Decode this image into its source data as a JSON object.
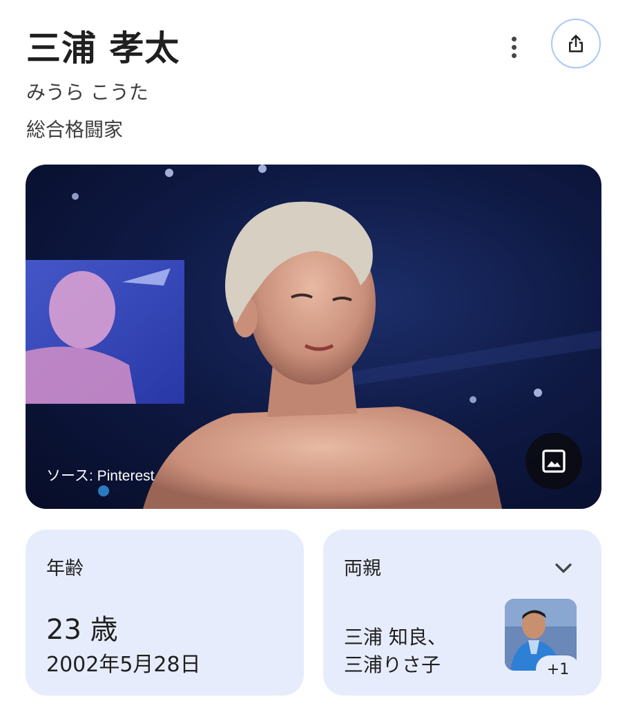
{
  "header": {
    "title": "三浦 孝太",
    "reading": "みうら こうた",
    "occupation": "総合格闘家"
  },
  "hero_image": {
    "source_label": "ソース: Pinterest"
  },
  "age_card": {
    "label": "年齢",
    "value": "23 歳",
    "birth_date": "2002年5月28日"
  },
  "parents_card": {
    "label": "両親",
    "names_line1": "三浦 知良、",
    "names_line2": "三浦りさ子",
    "more_count": "+1"
  },
  "icons": {
    "more": "more-vert-icon",
    "share": "share-icon",
    "image": "image-icon",
    "chevron": "chevron-down-icon"
  },
  "colors": {
    "card_bg": "#e6ecfb",
    "share_border": "#a8c7fa",
    "text": "#1f1f1f"
  }
}
